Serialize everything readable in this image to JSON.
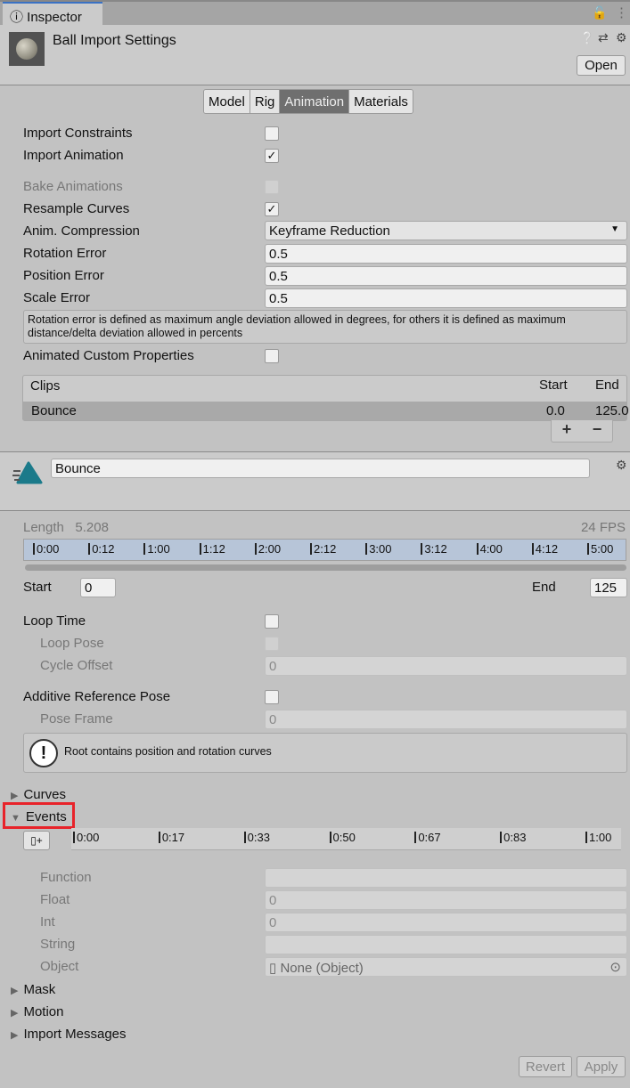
{
  "window": {
    "tab": "Inspector",
    "title": "Ball Import Settings",
    "open_label": "Open"
  },
  "tabs": [
    "Model",
    "Rig",
    "Animation",
    "Materials"
  ],
  "active_tab": "Animation",
  "settings": {
    "import_constraints": {
      "label": "Import Constraints",
      "checked": false
    },
    "import_animation": {
      "label": "Import Animation",
      "checked": true
    },
    "bake_animations": {
      "label": "Bake Animations",
      "checked": false,
      "disabled": true
    },
    "resample_curves": {
      "label": "Resample Curves",
      "checked": true
    },
    "anim_compression": {
      "label": "Anim. Compression",
      "value": "Keyframe Reduction"
    },
    "rotation_error": {
      "label": "Rotation Error",
      "value": "0.5"
    },
    "position_error": {
      "label": "Position Error",
      "value": "0.5"
    },
    "scale_error": {
      "label": "Scale Error",
      "value": "0.5"
    },
    "help": "Rotation error is defined as maximum angle deviation allowed in degrees, for others it is defined as maximum distance/delta deviation allowed in percents",
    "animated_custom_properties": {
      "label": "Animated Custom Properties",
      "checked": false
    }
  },
  "clips": {
    "header": "Clips",
    "col_start": "Start",
    "col_end": "End",
    "rows": [
      {
        "name": "Bounce",
        "start": "0.0",
        "end": "125.0"
      }
    ],
    "add": "+",
    "remove": "−"
  },
  "clip": {
    "name": "Bounce",
    "length_label": "Length",
    "length": "5.208",
    "fps": "24 FPS",
    "timeline_ticks": [
      "0:00",
      "0:12",
      "1:00",
      "1:12",
      "2:00",
      "2:12",
      "3:00",
      "3:12",
      "4:00",
      "4:12",
      "5:00"
    ],
    "start_label": "Start",
    "start": "0",
    "end_label": "End",
    "end": "125",
    "loop_time": "Loop Time",
    "loop_pose": "Loop Pose",
    "cycle_offset": "Cycle Offset",
    "cycle_offset_value": "0",
    "additive": "Additive Reference Pose",
    "pose_frame": "Pose Frame",
    "pose_frame_value": "0",
    "root_help": "Root contains position and rotation curves"
  },
  "sections": {
    "curves": "Curves",
    "events": "Events",
    "mask": "Mask",
    "motion": "Motion",
    "import_messages": "Import Messages"
  },
  "events": {
    "ticks": [
      "0:00",
      "0:17",
      "0:33",
      "0:50",
      "0:67",
      "0:83",
      "1:00"
    ],
    "function": "Function",
    "float": "Float",
    "float_value": "0",
    "int": "Int",
    "int_value": "0",
    "string": "String",
    "object": "Object",
    "object_value": "None (Object)"
  },
  "footer": {
    "revert": "Revert",
    "apply": "Apply"
  },
  "colors": {
    "highlight": "#e8232a",
    "clip_icon": "#1b7a8a",
    "active_tab": "#6f6f6f"
  }
}
